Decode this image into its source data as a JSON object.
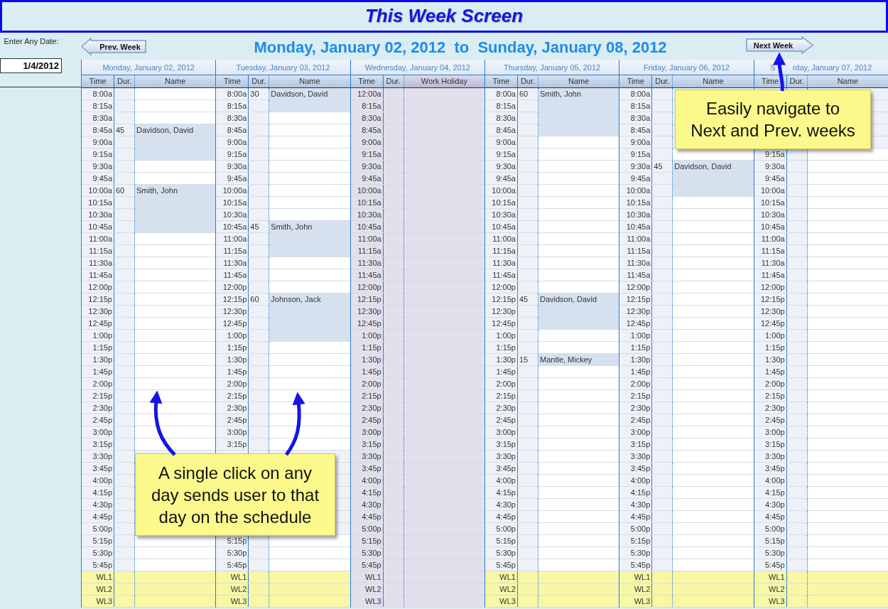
{
  "window": {
    "title": "This Week Screen"
  },
  "date_field": {
    "label": "Enter Any Date:",
    "value": "1/4/2012"
  },
  "nav": {
    "prev": "Prev. Week",
    "range": "Monday, January 02, 2012  to  Sunday, January 08, 2012",
    "next": "Next Week"
  },
  "days": [
    {
      "header": "Monday, January 02, 2012",
      "columns": [
        "Time",
        "Dur.",
        "Name"
      ],
      "holiday": false,
      "waitlist": [
        "WL1",
        "WL2",
        "WL3"
      ],
      "slots": [
        {
          "kind": "slot",
          "time": "8:00a",
          "booked": false
        },
        {
          "kind": "slot",
          "time": "8:15a",
          "booked": false
        },
        {
          "kind": "slot",
          "time": "8:30a",
          "booked": false
        },
        {
          "kind": "slot",
          "time": "8:45a",
          "dur": "45",
          "name": "Davidson, David",
          "booked": true
        },
        {
          "kind": "slot",
          "time": "9:00a",
          "booked": true
        },
        {
          "kind": "slot",
          "time": "9:15a",
          "booked": true
        },
        {
          "kind": "slot",
          "time": "9:30a",
          "booked": false
        },
        {
          "kind": "slot",
          "time": "9:45a",
          "booked": false
        },
        {
          "kind": "slot",
          "time": "10:00a",
          "dur": "60",
          "name": "Smith, John",
          "booked": true
        },
        {
          "kind": "slot",
          "time": "10:15a",
          "booked": true
        },
        {
          "kind": "slot",
          "time": "10:30a",
          "booked": true
        },
        {
          "kind": "slot",
          "time": "10:45a",
          "booked": true
        },
        {
          "kind": "slot",
          "time": "11:00a",
          "booked": false
        },
        {
          "kind": "slot",
          "time": "11:15a",
          "booked": false
        },
        {
          "kind": "slot",
          "time": "11:30a",
          "booked": false
        },
        {
          "kind": "slot",
          "time": "11:45a",
          "booked": false
        },
        {
          "kind": "slot",
          "time": "12:00p",
          "booked": false
        },
        {
          "kind": "slot",
          "time": "12:15p",
          "booked": false
        },
        {
          "kind": "slot",
          "time": "12:30p",
          "booked": false
        },
        {
          "kind": "slot",
          "time": "12:45p",
          "booked": false
        },
        {
          "kind": "slot",
          "time": "1:00p",
          "booked": false
        },
        {
          "kind": "slot",
          "time": "1:15p",
          "booked": false
        },
        {
          "kind": "slot",
          "time": "1:30p",
          "booked": false
        },
        {
          "kind": "slot",
          "time": "1:45p",
          "booked": false
        },
        {
          "kind": "slot",
          "time": "2:00p",
          "booked": false
        },
        {
          "kind": "slot",
          "time": "2:15p",
          "booked": false
        },
        {
          "kind": "slot",
          "time": "2:30p",
          "booked": false
        },
        {
          "kind": "slot",
          "time": "2:45p",
          "booked": false
        },
        {
          "kind": "slot",
          "time": "3:00p",
          "booked": false
        },
        {
          "kind": "slot",
          "time": "3:15p",
          "booked": false
        },
        {
          "kind": "slot",
          "time": "3:30p"
        },
        {
          "kind": "slot",
          "time": "3:45p"
        },
        {
          "kind": "slot",
          "time": "4:00p"
        },
        {
          "kind": "slot",
          "time": "4:15p"
        },
        {
          "kind": "slot",
          "time": "4:30p"
        },
        {
          "kind": "slot",
          "time": "4:45p"
        },
        {
          "kind": "slot",
          "time": "5:00p"
        },
        {
          "kind": "slot",
          "time": "5:15p",
          "booked": false
        },
        {
          "kind": "slot",
          "time": "5:30p",
          "booked": false
        },
        {
          "kind": "slot",
          "time": "5:45p",
          "booked": false
        }
      ]
    },
    {
      "header": "Tuesday, January 03, 2012",
      "columns": [
        "Time",
        "Dur.",
        "Name"
      ],
      "holiday": false,
      "waitlist": [
        "WL1",
        "WL2",
        "WL3"
      ],
      "slots": [
        {
          "kind": "slot",
          "time": "8:00a",
          "dur": "30",
          "name": "Davidson, David",
          "booked": true
        },
        {
          "kind": "slot",
          "time": "8:15a",
          "booked": true
        },
        {
          "kind": "slot",
          "time": "8:30a",
          "booked": false
        },
        {
          "kind": "slot",
          "time": "8:45a",
          "booked": false
        },
        {
          "kind": "slot",
          "time": "9:00a",
          "booked": false
        },
        {
          "kind": "slot",
          "time": "9:15a",
          "booked": false
        },
        {
          "kind": "slot",
          "time": "9:30a",
          "booked": false
        },
        {
          "kind": "slot",
          "time": "9:45a",
          "booked": false
        },
        {
          "kind": "slot",
          "time": "10:00a",
          "booked": false
        },
        {
          "kind": "slot",
          "time": "10:15a",
          "booked": false
        },
        {
          "kind": "slot",
          "time": "10:30a",
          "booked": false
        },
        {
          "kind": "slot",
          "time": "10:45a",
          "dur": "45",
          "name": "Smith, John",
          "booked": true
        },
        {
          "kind": "slot",
          "time": "11:00a",
          "booked": true
        },
        {
          "kind": "slot",
          "time": "11:15a",
          "booked": true
        },
        {
          "kind": "slot",
          "time": "11:30a",
          "booked": false
        },
        {
          "kind": "slot",
          "time": "11:45a",
          "booked": false
        },
        {
          "kind": "slot",
          "time": "12:00p",
          "booked": false
        },
        {
          "kind": "slot",
          "time": "12:15p",
          "dur": "60",
          "name": "Johnson, Jack",
          "booked": true
        },
        {
          "kind": "slot",
          "time": "12:30p",
          "booked": true
        },
        {
          "kind": "slot",
          "time": "12:45p",
          "booked": true
        },
        {
          "kind": "slot",
          "time": "1:00p",
          "booked": true
        },
        {
          "kind": "slot",
          "time": "1:15p",
          "booked": false
        },
        {
          "kind": "slot",
          "time": "1:30p",
          "booked": false
        },
        {
          "kind": "slot",
          "time": "1:45p",
          "booked": false
        },
        {
          "kind": "slot",
          "time": "2:00p",
          "booked": false
        },
        {
          "kind": "slot",
          "time": "2:15p",
          "booked": false
        },
        {
          "kind": "slot",
          "time": "2:30p",
          "booked": false
        },
        {
          "kind": "slot",
          "time": "2:45p",
          "booked": false
        },
        {
          "kind": "slot",
          "time": "3:00p",
          "booked": false
        },
        {
          "kind": "slot",
          "time": "3:15p",
          "booked": false
        },
        {
          "kind": "covered"
        },
        {
          "kind": "covered"
        },
        {
          "kind": "covered"
        },
        {
          "kind": "covered"
        },
        {
          "kind": "covered"
        },
        {
          "kind": "covered"
        },
        {
          "kind": "covered"
        },
        {
          "kind": "slot",
          "time": "5:15p",
          "booked": false
        },
        {
          "kind": "slot",
          "time": "5:30p",
          "booked": false
        },
        {
          "kind": "slot",
          "time": "5:45p",
          "booked": false
        }
      ]
    },
    {
      "header": "Wednesday, January 04, 2012",
      "columns": [
        "Time",
        "Dur.",
        "Work Holiday"
      ],
      "holiday": true,
      "waitlist": [
        "WL1",
        "WL2",
        "WL3"
      ],
      "slots": [
        {
          "kind": "slot",
          "time": "12:00a"
        },
        {
          "kind": "slot",
          "time": "8:15a"
        },
        {
          "kind": "slot",
          "time": "8:30a"
        },
        {
          "kind": "slot",
          "time": "8:45a"
        },
        {
          "kind": "slot",
          "time": "9:00a"
        },
        {
          "kind": "slot",
          "time": "9:15a"
        },
        {
          "kind": "slot",
          "time": "9:30a"
        },
        {
          "kind": "slot",
          "time": "9:45a"
        },
        {
          "kind": "slot",
          "time": "10:00a"
        },
        {
          "kind": "slot",
          "time": "10:15a"
        },
        {
          "kind": "slot",
          "time": "10:30a"
        },
        {
          "kind": "slot",
          "time": "10:45a"
        },
        {
          "kind": "slot",
          "time": "11:00a"
        },
        {
          "kind": "slot",
          "time": "11:15a"
        },
        {
          "kind": "slot",
          "time": "11:30a"
        },
        {
          "kind": "slot",
          "time": "11:45a"
        },
        {
          "kind": "slot",
          "time": "12:00p"
        },
        {
          "kind": "slot",
          "time": "12:15p"
        },
        {
          "kind": "slot",
          "time": "12:30p"
        },
        {
          "kind": "slot",
          "time": "12:45p"
        },
        {
          "kind": "slot",
          "time": "1:00p"
        },
        {
          "kind": "slot",
          "time": "1:15p"
        },
        {
          "kind": "slot",
          "time": "1:30p"
        },
        {
          "kind": "slot",
          "time": "1:45p"
        },
        {
          "kind": "slot",
          "time": "2:00p"
        },
        {
          "kind": "slot",
          "time": "2:15p"
        },
        {
          "kind": "slot",
          "time": "2:30p"
        },
        {
          "kind": "slot",
          "time": "2:45p"
        },
        {
          "kind": "slot",
          "time": "3:00p"
        },
        {
          "kind": "slot",
          "time": "3:15p"
        },
        {
          "kind": "slot",
          "time": "3:30p"
        },
        {
          "kind": "slot",
          "time": "3:45p"
        },
        {
          "kind": "slot",
          "time": "4:00p"
        },
        {
          "kind": "slot",
          "time": "4:15p"
        },
        {
          "kind": "slot",
          "time": "4:30p"
        },
        {
          "kind": "slot",
          "time": "4:45p"
        },
        {
          "kind": "slot",
          "time": "5:00p"
        },
        {
          "kind": "slot",
          "time": "5:15p"
        },
        {
          "kind": "slot",
          "time": "5:30p"
        },
        {
          "kind": "slot",
          "time": "5:45p"
        }
      ]
    },
    {
      "header": "Thursday, January 05, 2012",
      "columns": [
        "Time",
        "Dur.",
        "Name"
      ],
      "holiday": false,
      "waitlist": [
        "WL1",
        "WL2",
        "WL3"
      ],
      "slots": [
        {
          "kind": "slot",
          "time": "8:00a",
          "dur": "60",
          "name": "Smith, John",
          "booked": true
        },
        {
          "kind": "slot",
          "time": "8:15a",
          "booked": true
        },
        {
          "kind": "slot",
          "time": "8:30a",
          "booked": true
        },
        {
          "kind": "slot",
          "time": "8:45a",
          "booked": true
        },
        {
          "kind": "slot",
          "time": "9:00a",
          "booked": false
        },
        {
          "kind": "slot",
          "time": "9:15a",
          "booked": false
        },
        {
          "kind": "slot",
          "time": "9:30a",
          "booked": false
        },
        {
          "kind": "slot",
          "time": "9:45a",
          "booked": false
        },
        {
          "kind": "slot",
          "time": "10:00a",
          "booked": false
        },
        {
          "kind": "slot",
          "time": "10:15a",
          "booked": false
        },
        {
          "kind": "slot",
          "time": "10:30a",
          "booked": false
        },
        {
          "kind": "slot",
          "time": "10:45a",
          "booked": false
        },
        {
          "kind": "slot",
          "time": "11:00a",
          "booked": false
        },
        {
          "kind": "slot",
          "time": "11:15a",
          "booked": false
        },
        {
          "kind": "slot",
          "time": "11:30a",
          "booked": false
        },
        {
          "kind": "slot",
          "time": "11:45a",
          "booked": false
        },
        {
          "kind": "slot",
          "time": "12:00p",
          "booked": false
        },
        {
          "kind": "slot",
          "time": "12:15p",
          "dur": "45",
          "name": "Davidson, David",
          "booked": true
        },
        {
          "kind": "slot",
          "time": "12:30p",
          "booked": true
        },
        {
          "kind": "slot",
          "time": "12:45p",
          "booked": true
        },
        {
          "kind": "slot",
          "time": "1:00p",
          "booked": false
        },
        {
          "kind": "slot",
          "time": "1:15p",
          "booked": false
        },
        {
          "kind": "slot",
          "time": "1:30p",
          "dur": "15",
          "name": "Mantle, Mickey",
          "booked": true
        },
        {
          "kind": "slot",
          "time": "1:45p",
          "booked": false
        },
        {
          "kind": "slot",
          "time": "2:00p",
          "booked": false
        },
        {
          "kind": "slot",
          "time": "2:15p",
          "booked": false
        },
        {
          "kind": "slot",
          "time": "2:30p",
          "booked": false
        },
        {
          "kind": "slot",
          "time": "2:45p",
          "booked": false
        },
        {
          "kind": "slot",
          "time": "3:00p",
          "booked": false
        },
        {
          "kind": "slot",
          "time": "3:15p",
          "booked": false
        },
        {
          "kind": "slot",
          "time": "3:30p",
          "booked": false
        },
        {
          "kind": "slot",
          "time": "3:45p",
          "booked": false
        },
        {
          "kind": "slot",
          "time": "4:00p",
          "booked": false
        },
        {
          "kind": "slot",
          "time": "4:15p",
          "booked": false
        },
        {
          "kind": "slot",
          "time": "4:30p",
          "booked": false
        },
        {
          "kind": "slot",
          "time": "4:45p",
          "booked": false
        },
        {
          "kind": "slot",
          "time": "5:00p",
          "booked": false
        },
        {
          "kind": "slot",
          "time": "5:15p",
          "booked": false
        },
        {
          "kind": "slot",
          "time": "5:30p",
          "booked": false
        },
        {
          "kind": "slot",
          "time": "5:45p",
          "booked": false
        }
      ]
    },
    {
      "header": "Friday, January 06, 2012",
      "columns": [
        "Time",
        "Dur.",
        "Name"
      ],
      "holiday": false,
      "waitlist": [
        "WL1",
        "WL2",
        "WL3"
      ],
      "slots": [
        {
          "kind": "slot",
          "time": "8:00a"
        },
        {
          "kind": "slot",
          "time": "8:15a"
        },
        {
          "kind": "slot",
          "time": "8:30a"
        },
        {
          "kind": "slot",
          "time": "8:45a"
        },
        {
          "kind": "slot",
          "time": "9:00a"
        },
        {
          "kind": "slot",
          "time": "9:15a",
          "booked": false
        },
        {
          "kind": "slot",
          "time": "9:30a",
          "dur": "45",
          "name": "Davidson, David",
          "booked": true
        },
        {
          "kind": "slot",
          "time": "9:45a",
          "booked": true
        },
        {
          "kind": "slot",
          "time": "10:00a",
          "booked": true
        },
        {
          "kind": "slot",
          "time": "10:15a",
          "booked": false
        },
        {
          "kind": "slot",
          "time": "10:30a",
          "booked": false
        },
        {
          "kind": "slot",
          "time": "10:45a",
          "booked": false
        },
        {
          "kind": "slot",
          "time": "11:00a",
          "booked": false
        },
        {
          "kind": "slot",
          "time": "11:15a",
          "booked": false
        },
        {
          "kind": "slot",
          "time": "11:30a",
          "booked": false
        },
        {
          "kind": "slot",
          "time": "11:45a",
          "booked": false
        },
        {
          "kind": "slot",
          "time": "12:00p",
          "booked": false
        },
        {
          "kind": "slot",
          "time": "12:15p",
          "booked": false
        },
        {
          "kind": "slot",
          "time": "12:30p",
          "booked": false
        },
        {
          "kind": "slot",
          "time": "12:45p",
          "booked": false
        },
        {
          "kind": "slot",
          "time": "1:00p",
          "booked": false
        },
        {
          "kind": "slot",
          "time": "1:15p",
          "booked": false
        },
        {
          "kind": "slot",
          "time": "1:30p",
          "booked": false
        },
        {
          "kind": "slot",
          "time": "1:45p",
          "booked": false
        },
        {
          "kind": "slot",
          "time": "2:00p",
          "booked": false
        },
        {
          "kind": "slot",
          "time": "2:15p",
          "booked": false
        },
        {
          "kind": "slot",
          "time": "2:30p",
          "booked": false
        },
        {
          "kind": "slot",
          "time": "2:45p",
          "booked": false
        },
        {
          "kind": "slot",
          "time": "3:00p",
          "booked": false
        },
        {
          "kind": "slot",
          "time": "3:15p",
          "booked": false
        },
        {
          "kind": "slot",
          "time": "3:30p",
          "booked": false
        },
        {
          "kind": "slot",
          "time": "3:45p",
          "booked": false
        },
        {
          "kind": "slot",
          "time": "4:00p",
          "booked": false
        },
        {
          "kind": "slot",
          "time": "4:15p",
          "booked": false
        },
        {
          "kind": "slot",
          "time": "4:30p",
          "booked": false
        },
        {
          "kind": "slot",
          "time": "4:45p",
          "booked": false
        },
        {
          "kind": "slot",
          "time": "5:00p",
          "booked": false
        },
        {
          "kind": "slot",
          "time": "5:15p",
          "booked": false
        },
        {
          "kind": "slot",
          "time": "5:30p",
          "booked": false
        },
        {
          "kind": "slot",
          "time": "5:45p",
          "booked": false
        }
      ]
    },
    {
      "header_lead": "S",
      "header": "rday, January 07, 2012",
      "columns": [
        "Time",
        "Dur.",
        "Name"
      ],
      "holiday": false,
      "waitlist": [
        "WL1",
        "WL2",
        "WL3"
      ],
      "slots": [
        {
          "kind": "covered"
        },
        {
          "kind": "covered"
        },
        {
          "kind": "covered"
        },
        {
          "kind": "covered"
        },
        {
          "kind": "covered"
        },
        {
          "kind": "slot",
          "time": "9:15a",
          "booked": false
        },
        {
          "kind": "slot",
          "time": "9:30a",
          "booked": false
        },
        {
          "kind": "slot",
          "time": "9:45a",
          "booked": false
        },
        {
          "kind": "slot",
          "time": "10:00a",
          "booked": false
        },
        {
          "kind": "slot",
          "time": "10:15a",
          "booked": false
        },
        {
          "kind": "slot",
          "time": "10:30a",
          "booked": false
        },
        {
          "kind": "slot",
          "time": "10:45a",
          "booked": false
        },
        {
          "kind": "slot",
          "time": "11:00a",
          "booked": false
        },
        {
          "kind": "slot",
          "time": "11:15a",
          "booked": false
        },
        {
          "kind": "slot",
          "time": "11:30a",
          "booked": false
        },
        {
          "kind": "slot",
          "time": "11:45a",
          "booked": false
        },
        {
          "kind": "slot",
          "time": "12:00p",
          "booked": false
        },
        {
          "kind": "slot",
          "time": "12:15p",
          "booked": false
        },
        {
          "kind": "slot",
          "time": "12:30p",
          "booked": false
        },
        {
          "kind": "slot",
          "time": "12:45p",
          "booked": false
        },
        {
          "kind": "slot",
          "time": "1:00p",
          "booked": false
        },
        {
          "kind": "slot",
          "time": "1:15p",
          "booked": false
        },
        {
          "kind": "slot",
          "time": "1:30p",
          "booked": false
        },
        {
          "kind": "slot",
          "time": "1:45p",
          "booked": false
        },
        {
          "kind": "slot",
          "time": "2:00p",
          "booked": false
        },
        {
          "kind": "slot",
          "time": "2:15p",
          "booked": false
        },
        {
          "kind": "slot",
          "time": "2:30p",
          "booked": false
        },
        {
          "kind": "slot",
          "time": "2:45p",
          "booked": false
        },
        {
          "kind": "slot",
          "time": "3:00p",
          "booked": false
        },
        {
          "kind": "slot",
          "time": "3:15p",
          "booked": false
        },
        {
          "kind": "slot",
          "time": "3:30p",
          "booked": false
        },
        {
          "kind": "slot",
          "time": "3:45p",
          "booked": false
        },
        {
          "kind": "slot",
          "time": "4:00p",
          "booked": false
        },
        {
          "kind": "slot",
          "time": "4:15p",
          "booked": false
        },
        {
          "kind": "slot",
          "time": "4:30p",
          "booked": false
        },
        {
          "kind": "slot",
          "time": "4:45p",
          "booked": false
        },
        {
          "kind": "slot",
          "time": "5:00p",
          "booked": false
        },
        {
          "kind": "slot",
          "time": "5:15p",
          "booked": false
        },
        {
          "kind": "slot",
          "time": "5:30p",
          "booked": false
        },
        {
          "kind": "slot",
          "time": "5:45p",
          "booked": false
        }
      ]
    }
  ],
  "callouts": [
    {
      "text": "A single click on any day sends user to that day on the schedule"
    },
    {
      "text": "Easily navigate to Next and Prev. weeks"
    }
  ]
}
